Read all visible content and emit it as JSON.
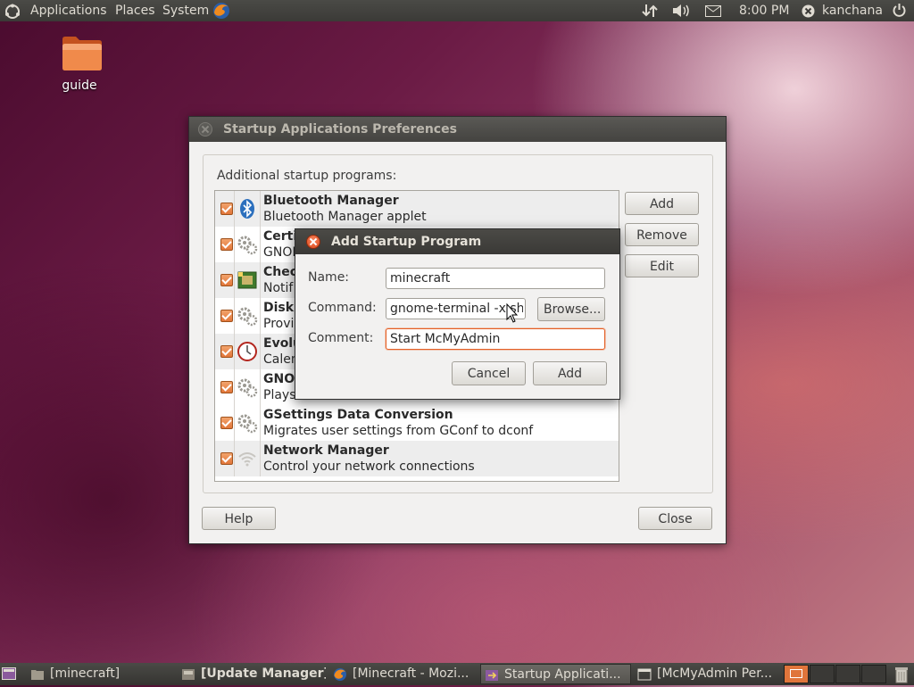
{
  "top_panel": {
    "menus": [
      "Applications",
      "Places",
      "System"
    ],
    "clock": "8:00 PM",
    "user": "kanchana"
  },
  "desktop": {
    "icons": [
      {
        "label": "guide"
      }
    ]
  },
  "startup_window": {
    "title": "Startup Applications Preferences",
    "section_label": "Additional startup programs:",
    "programs": [
      {
        "name": "Bluetooth Manager",
        "description": "Bluetooth Manager applet",
        "icon": "bluetooth-icon"
      },
      {
        "name": "Certi",
        "description": "GNOM",
        "icon": "gears-icon"
      },
      {
        "name": "Check",
        "description": "Notif",
        "icon": "package-icon"
      },
      {
        "name": "Disk",
        "description": "Provi",
        "icon": "gears-icon"
      },
      {
        "name": "Evolu",
        "description": "Calen",
        "icon": "clock-icon"
      },
      {
        "name": "GNOI",
        "description": "Plays",
        "icon": "gears-icon"
      },
      {
        "name": "GSettings Data Conversion",
        "description": "Migrates user settings from GConf to dconf",
        "icon": "gears-icon"
      },
      {
        "name": "Network Manager",
        "description": "Control your network connections",
        "icon": "wifi-icon"
      }
    ],
    "buttons": {
      "add": "Add",
      "remove": "Remove",
      "edit": "Edit",
      "help": "Help",
      "close": "Close"
    }
  },
  "add_dialog": {
    "title": "Add Startup Program",
    "name_label": "Name:",
    "name_value": "minecraft",
    "command_label": "Command:",
    "command_value": "gnome-terminal -x sh -c",
    "browse_label": "Browse...",
    "comment_label": "Comment:",
    "comment_value": "Start McMyAdmin",
    "cancel_label": "Cancel",
    "add_label": "Add"
  },
  "taskbar": {
    "tasks": [
      {
        "label": "[minecraft]",
        "icon": "folder-icon"
      },
      {
        "label": "[Update Manager]",
        "icon": "update-icon"
      },
      {
        "label": "[Minecraft - Mozi...",
        "icon": "firefox-icon"
      },
      {
        "label": "Startup Applicati...",
        "icon": "startup-icon"
      },
      {
        "label": "[McMyAdmin Per...",
        "icon": "window-icon"
      }
    ]
  },
  "colors": {
    "accent": "#e2763a",
    "panel": "#3c3b37"
  }
}
